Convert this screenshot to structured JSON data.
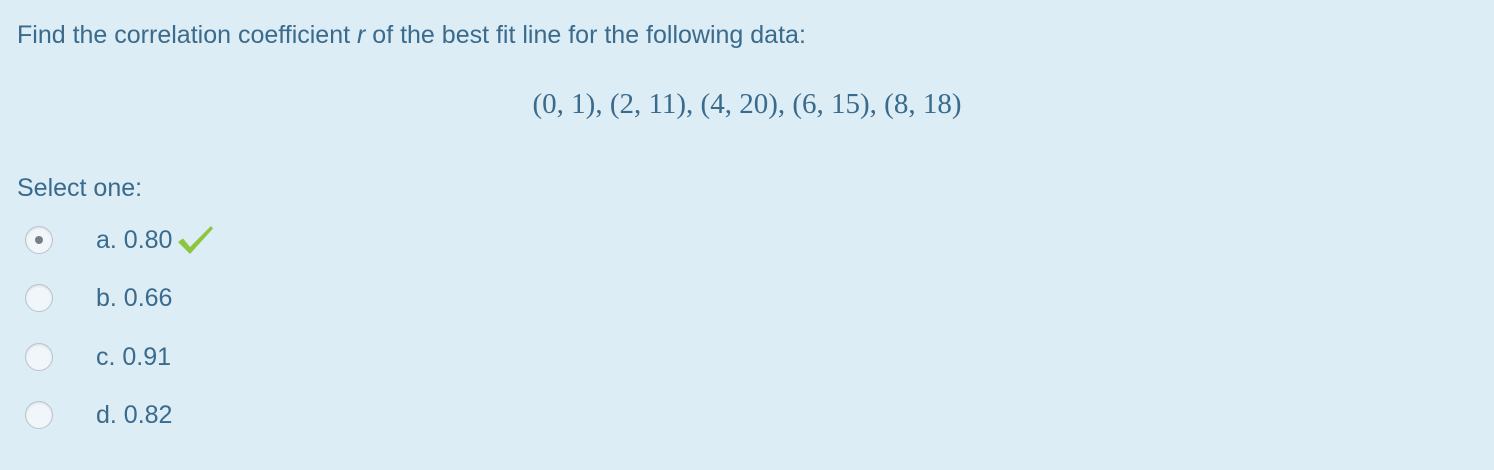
{
  "question": {
    "text_before": "Find the correlation coefficient ",
    "variable": "r",
    "text_after": " of the best fit line for the following data:"
  },
  "data_points": "(0, 1), (2, 11), (4, 20), (6, 15), (8, 18)",
  "prompt": "Select one:",
  "options": [
    {
      "label": "a. 0.80",
      "selected": true,
      "feedback": "correct"
    },
    {
      "label": "b. 0.66",
      "selected": false
    },
    {
      "label": "c. 0.91",
      "selected": false
    },
    {
      "label": "d. 0.82",
      "selected": false
    }
  ],
  "colors": {
    "background": "#dcedf6",
    "text": "#3a6a8c",
    "check": "#8cc63f"
  },
  "icons": {
    "correct": "check-mark-icon"
  }
}
